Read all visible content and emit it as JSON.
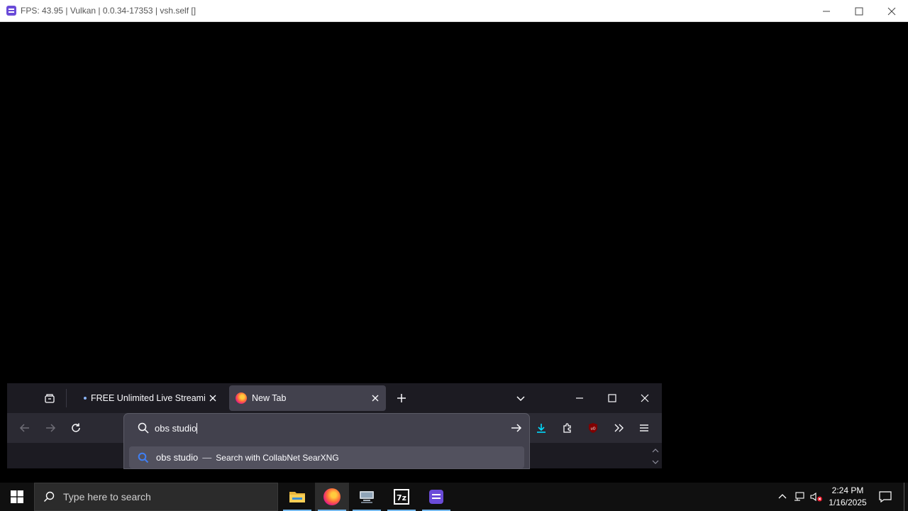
{
  "window": {
    "title": "FPS: 43.95 | Vulkan | 0.0.34-17353 | vsh.self []",
    "minimize_icon": "minimize-icon",
    "maximize_icon": "maximize-icon",
    "close_icon": "close-icon"
  },
  "browser": {
    "tabs": [
      {
        "label": "FREE Unlimited Live Streaming,",
        "active": false
      },
      {
        "label": "New Tab",
        "active": true
      }
    ],
    "urlbar": {
      "value": "obs studio",
      "suggestion": {
        "text": "obs studio",
        "separator": "—",
        "engine": "Search with CollabNet SearXNG"
      }
    },
    "accent_color": "#00ddff"
  },
  "taskbar": {
    "search_placeholder": "Type here to search",
    "apps": [
      "file-explorer-icon",
      "firefox-icon",
      "network-drive-icon",
      "7zip-icon",
      "rpcs3-icon"
    ],
    "time": "2:24 PM",
    "date": "1/16/2025"
  }
}
